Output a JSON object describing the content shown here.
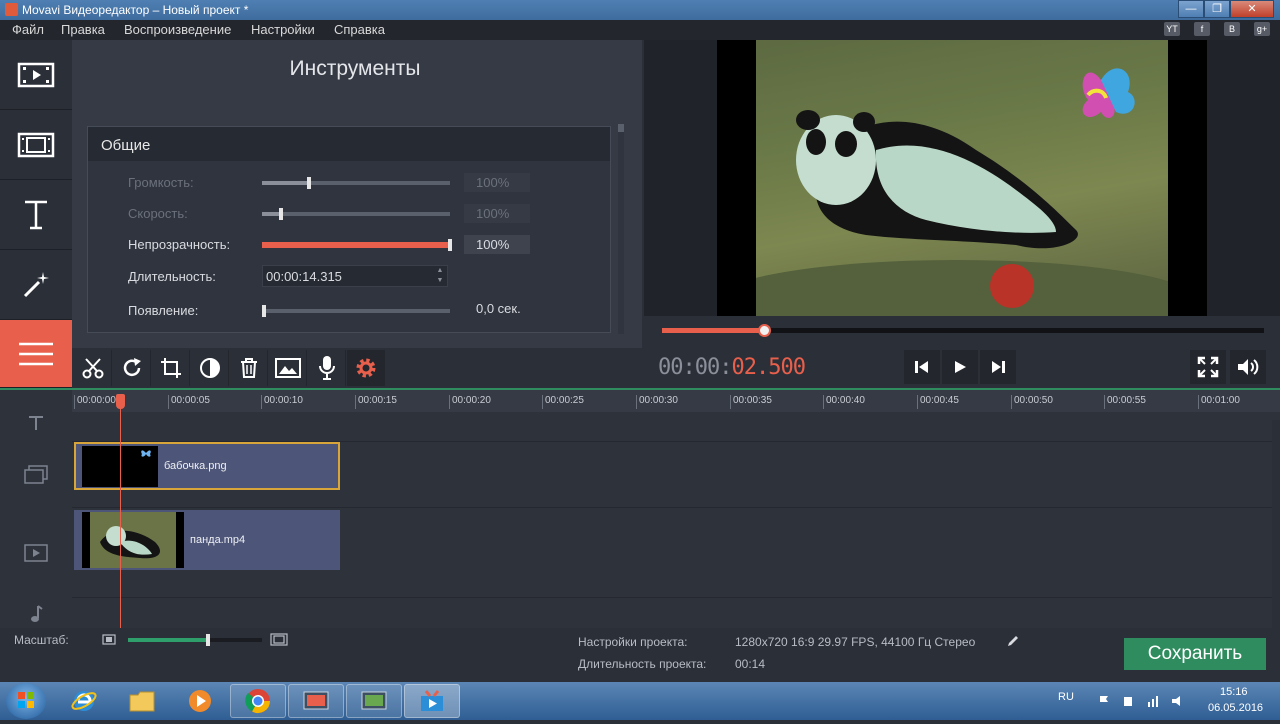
{
  "window": {
    "title": "Movavi Видеоредактор – Новый проект *",
    "minimize": "—",
    "maximize": "❐",
    "close": "✕"
  },
  "menu": {
    "file": "Файл",
    "edit": "Правка",
    "playback": "Воспроизведение",
    "settings": "Настройки",
    "help": "Справка",
    "right_icons": [
      "YT",
      "f",
      "В",
      "g+"
    ]
  },
  "rail": [
    "film-import-icon",
    "filters-icon",
    "titles-icon",
    "transitions-icon",
    "more-tools-icon"
  ],
  "tools": {
    "title": "Инструменты",
    "group_title": "Общие",
    "volume": {
      "label": "Громкость:",
      "value": "100%",
      "level": 0.25
    },
    "speed": {
      "label": "Скорость:",
      "value": "100%",
      "level": 0.1
    },
    "opacity": {
      "label": "Непрозрачность:",
      "value": "100%",
      "level": 1.0
    },
    "duration": {
      "label": "Длительность:",
      "value": "00:00:14.315"
    },
    "fade_in": {
      "label": "Появление:",
      "value": "0,0 сек.",
      "level": 0.0
    }
  },
  "toolbar": [
    "cut-icon",
    "rotate-icon",
    "crop-icon",
    "color-adjust-icon",
    "delete-icon",
    "image-icon",
    "microphone-icon",
    "settings-gear-icon"
  ],
  "player": {
    "timecode_dim": "00:00:",
    "timecode_live": "02.500",
    "progress": 0.17
  },
  "ruler_ticks": [
    "00:00:00",
    "00:00:05",
    "00:00:10",
    "00:00:15",
    "00:00:20",
    "00:00:25",
    "00:00:30",
    "00:00:35",
    "00:00:40",
    "00:00:45",
    "00:00:50",
    "00:00:55",
    "00:01:00"
  ],
  "tracks": {
    "overlay_clip": "бабочка.png",
    "video_clip": "панда.mp4"
  },
  "bottom": {
    "zoom_label": "Масштаб:",
    "zoom_level": 0.6,
    "project_settings_label": "Настройки проекта:",
    "project_settings_value": "1280x720 16:9 29.97 FPS, 44100 Гц Стерео",
    "project_duration_label": "Длительность проекта:",
    "project_duration_value": "00:14",
    "save_label": "Сохранить"
  },
  "taskbar": {
    "lang": "RU",
    "time": "15:16",
    "date": "06.05.2016"
  },
  "colors": {
    "accent": "#e8604c",
    "save": "#2e8c5f",
    "panel": "#353a45"
  }
}
